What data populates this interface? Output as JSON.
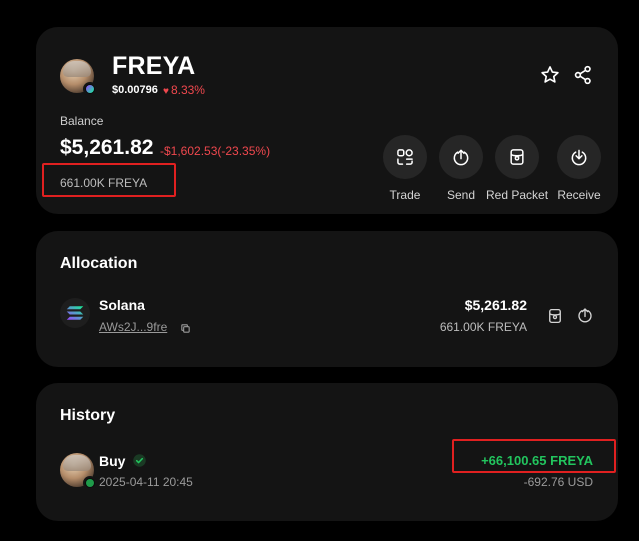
{
  "token": {
    "name": "FREYA",
    "price": "$0.00796",
    "change": "8.33%",
    "balance_label": "Balance",
    "balance_value": "$5,261.82",
    "balance_change": "-$1,602.53(-23.35%)",
    "balance_amount": "661.00K FREYA",
    "star_icon": "star-icon",
    "share_icon": "share-icon"
  },
  "actions": [
    {
      "label": "Trade",
      "icon": "trade-icon"
    },
    {
      "label": "Send",
      "icon": "send-icon"
    },
    {
      "label": "Red Packet",
      "icon": "red-packet-icon"
    },
    {
      "label": "Receive",
      "icon": "receive-icon"
    }
  ],
  "allocation": {
    "title": "Allocation",
    "items": [
      {
        "name": "Solana",
        "address": "AWs2J...9fre",
        "value": "$5,261.82",
        "amount": "661.00K  FREYA"
      }
    ]
  },
  "history": {
    "title": "History",
    "items": [
      {
        "type": "Buy",
        "time": "2025-04-11 20:45",
        "amount": "+66,100.65 FREYA",
        "usd": "-692.76 USD"
      }
    ]
  },
  "colors": {
    "negative": "#f0484e",
    "positive": "#22c55e",
    "highlight": "#e02020",
    "card": "#141414"
  }
}
